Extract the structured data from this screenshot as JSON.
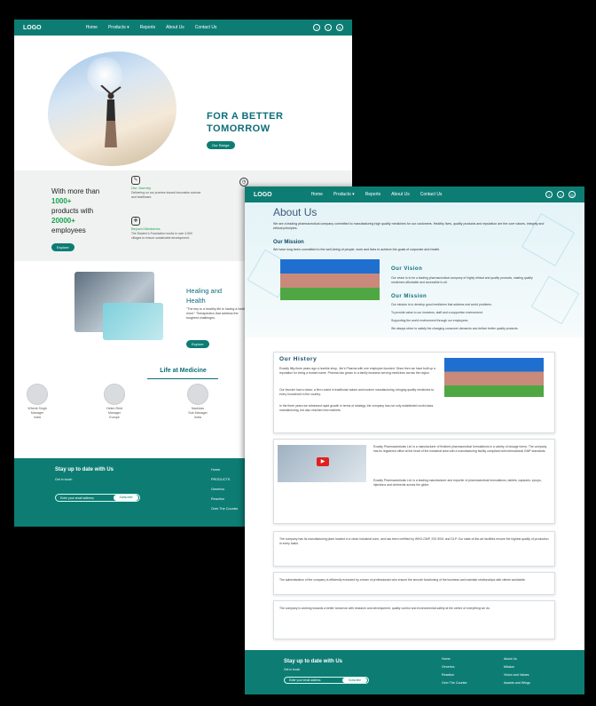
{
  "page_a": {
    "nav": {
      "logo": "LOGO",
      "links": [
        "Home",
        "Products ▾",
        "Reports",
        "About Us",
        "Contact Us"
      ]
    },
    "hero": {
      "title_line1": "FOR A BETTER",
      "title_line2": "TOMORROW",
      "button": "Our Range"
    },
    "stats": {
      "line1": "With more than",
      "line2": "1000+",
      "line3": "products with",
      "line4": "20000+",
      "line5": "employees",
      "button": "Explore",
      "features": [
        {
          "title": "Our Journey",
          "text": "Delivering on our promise toward innovative science and healthcare."
        },
        {
          "title": "Beyond Medicines",
          "text": "The Modern's Foundation works in over 4,500 villages to ensure sustainable development."
        }
      ]
    },
    "healing": {
      "title_line1": "Healing and",
      "title_line2": "Health",
      "text": "\"The key to a healthy life is having a healthy mind.\" Therapeutics that address the toughest challenges.",
      "button": "Explore"
    },
    "life": {
      "title": "Life at Medicine",
      "people": [
        {
          "name": "Whenk Singh",
          "role": "Manager",
          "place": "India"
        },
        {
          "name": "Helen Reid",
          "role": "Manager",
          "place": "Europe"
        },
        {
          "name": "Nachdas",
          "role": "Sub Manager",
          "place": "India"
        }
      ]
    },
    "footer": {
      "title": "Stay up to date with Us",
      "sub": "Get in touch",
      "placeholder": "Enter your email address",
      "button": "Subscribe",
      "col": [
        "Home",
        "PRODUCTS",
        "Generics",
        "Reaction",
        "Over The Counter"
      ]
    }
  },
  "page_b": {
    "nav": {
      "logo": "LOGO",
      "links": [
        "Home",
        "Products ▾",
        "Reports",
        "About Us",
        "Contact Us"
      ]
    },
    "about": {
      "title": "About Us",
      "intro": "We are a leading pharmaceutical company committed to manufacturing high quality medicines for our customers. Healthy lives, quality products and reputation are the core values, integrity and ethical principles.",
      "our_mission_title": "Our Mission",
      "our_mission_text": "We have long been committed to the well-being of people, work and lives to achieve the goals of corporate and health.",
      "vision_title": "Our Vision",
      "vision_text": "Our vision is to be a leading pharmaceutical company of highly ethical and quality products, making quality medicines affordable and accessible to all.",
      "mission_title": "Our Mission",
      "mission_points": [
        "Our mission is to develop good medicines that address real world problems.",
        "To provide value to our investors, staff and a supportive environment.",
        "Supporting the world environment through our employees.",
        "We always strive to satisfy the changing consumer demands and deliver better quality products."
      ]
    },
    "history": {
      "title": "Our History",
      "p1": "Exactly fifty-three years ago a humble shop, Jim's Pharma with one employee founded. Since then we have built up a reputation for being a trusted name. Pharma has grown to a family business serving medicines across the region.",
      "p2": "Our founder had a vision: a firm rooted in traditional values and modern manufacturing, bringing quality medicines to every household in the country.",
      "p3": "In the three years we witnessed rapid growth in terms of strategy, the company has not only established world-class manufacturing, but also reached new markets."
    },
    "video_card": {
      "p1": "Exactly Pharmaceuticals Ltd. is a manufacturer of finished pharmaceutical formulations in a variety of dosage forms. The company has its registered office at the heart of the industrial area with a manufacturing facility compliant with international GMP standards.",
      "p2": "Exactly Pharmaceuticals Ltd. is a leading manufacturer and exporter of pharmaceutical formulations, tablets, capsules, syrups, injections and ointments across the globe."
    },
    "cards": [
      "The company has its manufacturing plant located in a clean industrial zone, and has been certified by WHO-GMP, ISO 9001 and GLP. Our state-of-the-art facilities ensure the highest quality of production in every batch.",
      "The administration of the company is efficiently executed by a team of professionals who ensure the smooth functioning of the business and maintain relationships with clients worldwide.",
      "The company is working towards a better tomorrow with research and development, quality control and environmental safety at the centre of everything we do."
    ],
    "footer": {
      "title": "Stay up to date with Us",
      "sub": "Get in touch",
      "placeholder": "Enter your email address",
      "button": "Subscribe",
      "col1": [
        "Home",
        "Generics",
        "Reaction",
        "Over The Counter"
      ],
      "col2": [
        "About Us",
        "Mission",
        "Vision and Values",
        "Awards and Wings"
      ]
    }
  }
}
